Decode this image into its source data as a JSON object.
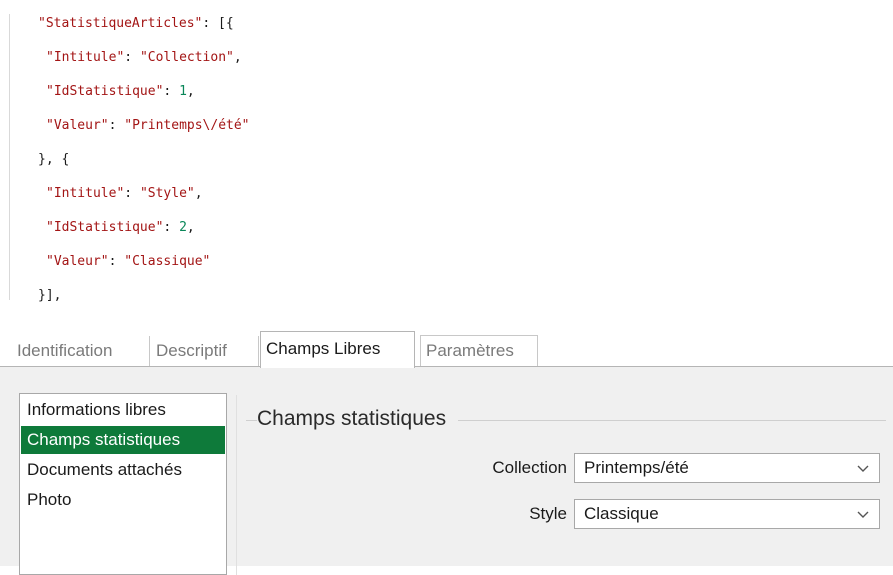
{
  "code": {
    "l1_key": "\"StatistiqueArticles\"",
    "l1_rest": ": [{",
    "l2_key": "\"Intitule\"",
    "l2_val": "\"Collection\"",
    "l3_key": "\"IdStatistique\"",
    "l3_val": "1",
    "l4_key": "\"Valeur\"",
    "l4_val": "\"Printemps\\/été\"",
    "l5": "}, {",
    "l6_key": "\"Intitule\"",
    "l6_val": "\"Style\"",
    "l7_key": "\"IdStatistique\"",
    "l7_val": "2",
    "l8_key": "\"Valeur\"",
    "l8_val": "\"Classique\"",
    "l9": "}],"
  },
  "tabs": [
    "Identification",
    "Descriptif",
    "Champs Libres",
    "Paramètres"
  ],
  "active_tab": "Champs Libres",
  "sidebar": {
    "items": [
      "Informations libres",
      "Champs statistiques",
      "Documents attachés",
      "Photo"
    ],
    "selected": "Champs statistiques"
  },
  "group": {
    "title": "Champs statistiques"
  },
  "fields": [
    {
      "label": "Collection",
      "value": "Printemps/été"
    },
    {
      "label": "Style",
      "value": "Classique"
    }
  ],
  "colors": {
    "selection": "#0e7a3a",
    "code_string": "#a31515",
    "code_number": "#098658"
  },
  "icons": {
    "dropdown": "chevron-down-icon"
  }
}
